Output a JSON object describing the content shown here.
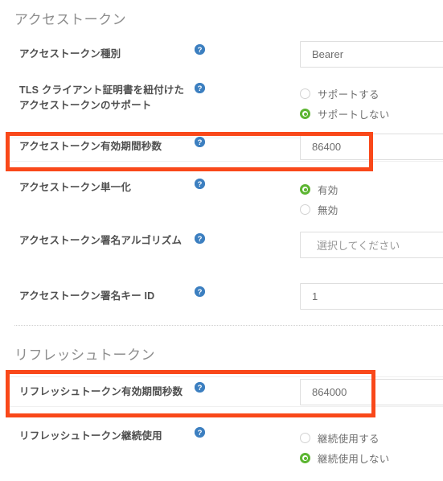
{
  "page": {
    "language": "ja",
    "accent_red": "#f9481a",
    "accent_green": "#5cb531",
    "help_icon_blue": "#3c7fc0"
  },
  "sections": [
    {
      "id": "access-token",
      "title": "アクセストークン",
      "rows": [
        {
          "id": "access-token-type",
          "label": "アクセストークン種別",
          "help": "help-icon",
          "control": {
            "kind": "text",
            "value": "Bearer"
          }
        },
        {
          "id": "tls-bound-access-token-support",
          "label": "TLS クライアント証明書を紐付けたアクセストークンのサポート",
          "help": "help-icon",
          "control": {
            "kind": "radio",
            "options": [
              {
                "label": "サポートする",
                "selected": false
              },
              {
                "label": "サポートしない",
                "selected": true
              }
            ]
          }
        },
        {
          "id": "access-token-duration",
          "label": "アクセストークン有効期間秒数",
          "help": "help-icon",
          "highlighted": true,
          "control": {
            "kind": "text",
            "value": "86400"
          }
        },
        {
          "id": "access-token-single",
          "label": "アクセストークン単一化",
          "help": "help-icon",
          "control": {
            "kind": "radio",
            "options": [
              {
                "label": "有効",
                "selected": true
              },
              {
                "label": "無効",
                "selected": false
              }
            ]
          }
        },
        {
          "id": "access-token-signature-algorithm",
          "label": "アクセストークン署名アルゴリズム",
          "help": "help-icon",
          "control": {
            "kind": "select",
            "value": "選択してください",
            "is_placeholder": true
          }
        },
        {
          "id": "access-token-signature-key-id",
          "label": "アクセストークン署名キー ID",
          "help": "help-icon",
          "control": {
            "kind": "text",
            "value": "1"
          }
        }
      ]
    },
    {
      "id": "refresh-token",
      "title": "リフレッシュトークン",
      "rows": [
        {
          "id": "refresh-token-duration",
          "label": "リフレッシュトークン有効期間秒数",
          "help": "help-icon",
          "highlighted": true,
          "control": {
            "kind": "text",
            "value": "864000"
          }
        },
        {
          "id": "refresh-token-kept",
          "label": "リフレッシュトークン継続使用",
          "help": "help-icon",
          "control": {
            "kind": "radio",
            "options": [
              {
                "label": "継続使用する",
                "selected": false
              },
              {
                "label": "継続使用しない",
                "selected": true
              }
            ]
          }
        }
      ]
    }
  ]
}
